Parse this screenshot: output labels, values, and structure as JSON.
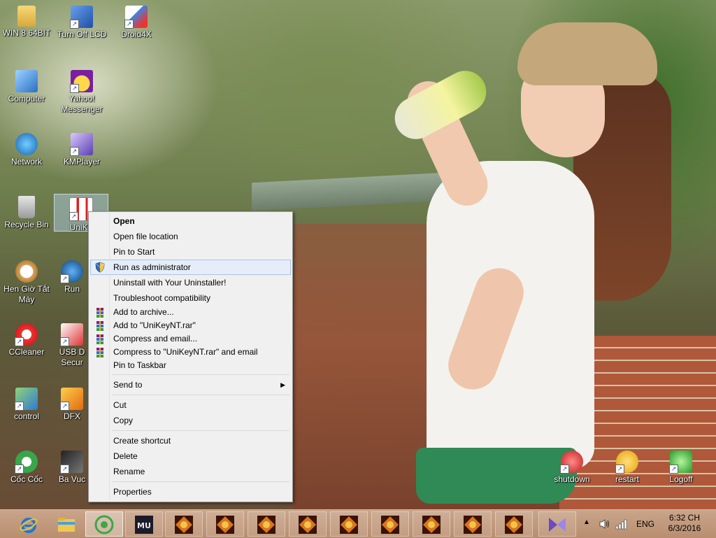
{
  "desktop": {
    "icons": [
      {
        "label": "WIN 8 64BIT"
      },
      {
        "label": "Turn Off LCD"
      },
      {
        "label": "Droid4X"
      },
      {
        "label": "Computer"
      },
      {
        "label": "Yahoo! Messenger"
      },
      {
        "label": "Network"
      },
      {
        "label": "KMPlayer"
      },
      {
        "label": "Recycle Bin"
      },
      {
        "label": "UniKe"
      },
      {
        "label": "Hen Giờ Tắt Máy"
      },
      {
        "label": "Run"
      },
      {
        "label": "CCleaner"
      },
      {
        "label": "USB D Secur"
      },
      {
        "label": "control"
      },
      {
        "label": "DFX"
      },
      {
        "label": "Cốc Cốc"
      },
      {
        "label": "Ba Vuc"
      },
      {
        "label": "shutdown"
      },
      {
        "label": "restart"
      },
      {
        "label": "Logoff"
      }
    ]
  },
  "context_menu": {
    "open": "Open",
    "open_file_location": "Open file location",
    "pin_to_start": "Pin to Start",
    "run_as_admin": "Run as administrator",
    "uninstall": "Uninstall with Your Uninstaller!",
    "troubleshoot": "Troubleshoot compatibility",
    "add_to_archive": "Add to archive...",
    "add_to_rar": "Add to \"UniKeyNT.rar\"",
    "compress_email": "Compress and email...",
    "compress_rar_email": "Compress to \"UniKeyNT.rar\" and email",
    "pin_to_taskbar": "Pin to Taskbar",
    "send_to": "Send to",
    "cut": "Cut",
    "copy": "Copy",
    "create_shortcut": "Create shortcut",
    "delete": "Delete",
    "rename": "Rename",
    "properties": "Properties"
  },
  "taskbar": {
    "language": "ENG",
    "time": "6:32 CH",
    "date": "6/3/2016",
    "pinned_icons": [
      "internet-explorer-icon",
      "file-explorer-icon",
      "coc-coc-icon",
      "mu-game-icon",
      "game-icon",
      "game-icon",
      "game-icon",
      "game-icon",
      "game-icon",
      "game-icon",
      "game-icon",
      "game-icon",
      "game-icon",
      "kmplayer-icon"
    ]
  },
  "colors": {
    "menu_bg": "#f0f0f0",
    "menu_highlight": "#e5eef8",
    "taskbar": "#c29c7e"
  }
}
